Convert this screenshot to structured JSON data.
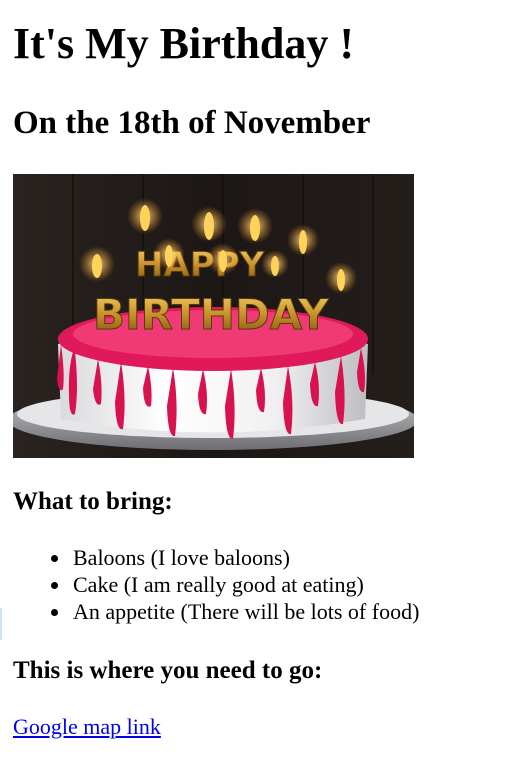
{
  "page": {
    "title": "It's My Birthday !",
    "subtitle": "On the 18th of November"
  },
  "image": {
    "icon": "birthday-cake-image",
    "candle_letters": "HAPPY BIRTHDAY"
  },
  "bring": {
    "heading": "What to bring:",
    "items": [
      "Baloons (I love baloons)",
      "Cake (I am really good at eating)",
      "An appetite (There will be lots of food)"
    ]
  },
  "location": {
    "heading": "This is where you need to go:",
    "link_text": "Google map link"
  },
  "colors": {
    "link": "#0000ee",
    "frosting": "#e0195a"
  }
}
